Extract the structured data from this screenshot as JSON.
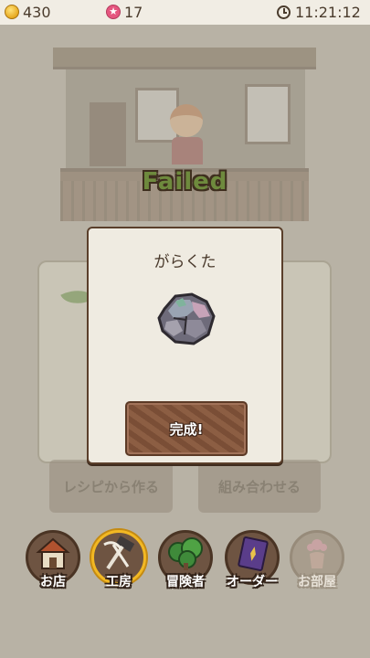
{
  "status": {
    "coins": "430",
    "gems": "17",
    "time": "11:21:12"
  },
  "scene": {
    "result_label": "Failed"
  },
  "background_buttons": {
    "recipe": "レシピから作る",
    "combine": "組み合わせる"
  },
  "dialog": {
    "item_name": "がらくた",
    "item_icon": "junk-rock-icon",
    "complete_label": "完成!"
  },
  "nav": {
    "items": [
      {
        "label": "お店",
        "icon": "shop-icon"
      },
      {
        "label": "工房",
        "icon": "workshop-hammer-icon"
      },
      {
        "label": "冒険者",
        "icon": "tree-icon"
      },
      {
        "label": "オーダー",
        "icon": "order-book-icon"
      },
      {
        "label": "お部屋",
        "icon": "room-vase-icon"
      }
    ]
  },
  "colors": {
    "accent_active": "#f2b823",
    "failed_text": "#6c8a3a",
    "button_wood": "#8c5e43"
  }
}
